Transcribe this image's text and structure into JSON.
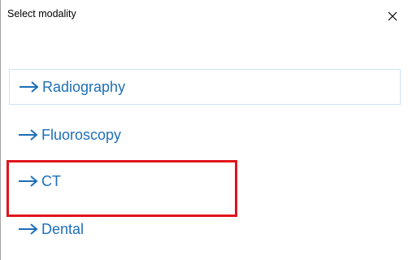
{
  "dialog": {
    "title": "Select modality"
  },
  "options": [
    {
      "label": "Radiography",
      "focused": true
    },
    {
      "label": "Fluoroscopy",
      "focused": false
    },
    {
      "label": "CT",
      "focused": false
    },
    {
      "label": "Dental",
      "focused": false
    }
  ],
  "icons": {
    "close": "close-icon",
    "arrow": "arrow-right-icon"
  },
  "colors": {
    "link": "#1e6fb8",
    "highlight": "#e0141b",
    "focus_border": "#cfe2f5"
  }
}
